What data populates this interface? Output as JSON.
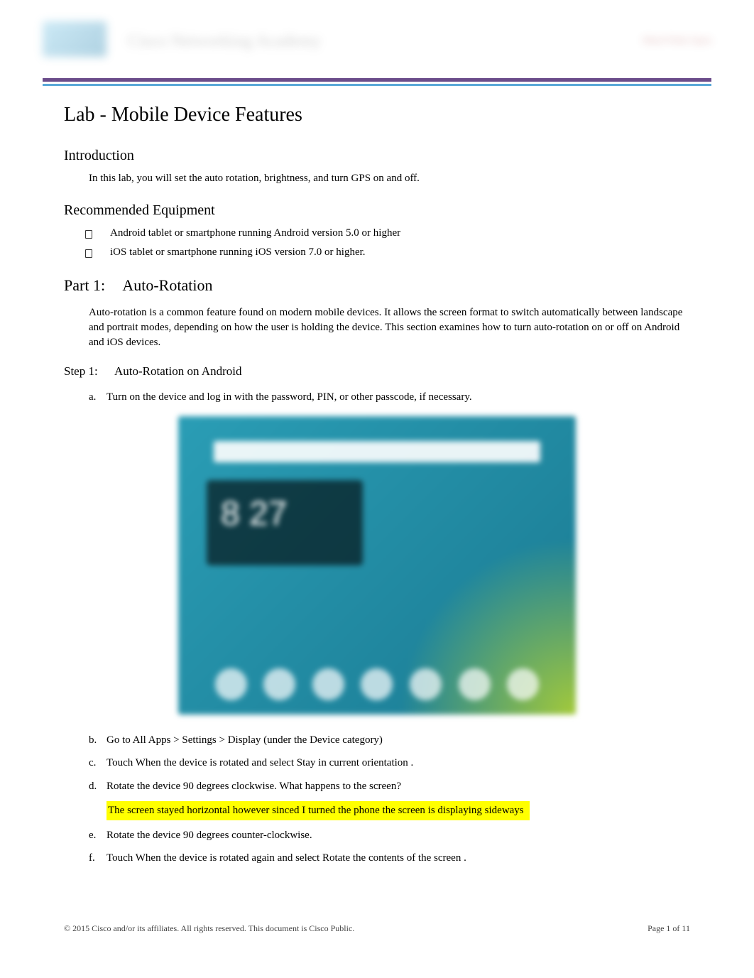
{
  "header": {
    "banner_title": "Cisco Networking Academy",
    "banner_right": "Mind Wide Open"
  },
  "title": "Lab - Mobile Device Features",
  "introduction": {
    "heading": "Introduction",
    "text": "In this lab, you will set the auto rotation, brightness, and turn GPS on and off."
  },
  "recommended": {
    "heading": "Recommended Equipment",
    "items": [
      "Android tablet or smartphone running Android version 5.0 or higher",
      "iOS tablet or smartphone running iOS version 7.0 or higher."
    ]
  },
  "part1": {
    "label": "Part 1:",
    "title": "Auto-Rotation",
    "body": "Auto-rotation is a common feature found on modern mobile devices. It allows the screen format to switch automatically between   landscape   and  portrait  modes, depending on how the user is holding the device. This section examines how to turn    auto-rotation   on or off on Android and iOS devices."
  },
  "step1": {
    "label": "Step 1:",
    "title": "Auto-Rotation on Android",
    "items": {
      "a": "Turn on the device and log in with the password, PIN, or other passcode, if necessary.",
      "b": "Go to  All Apps > Settings > Display      (under the   Device  category)",
      "c": "Touch  When the device is rotated      and select   Stay in current orientation      .",
      "d": "Rotate the device 90 degrees clockwise. What happens to the screen?",
      "d_answer": "The screen stayed horizontal however sinced I turned the phone the screen is displaying sideways",
      "e": "Rotate the device 90 degrees counter-clockwise.",
      "f": "Touch  When the device is rotated      again and select    Rotate the contents of the screen       ."
    }
  },
  "screenshot": {
    "widget_time": "8 27"
  },
  "footer": {
    "copyright": "© 2015 Cisco and/or its affiliates. All rights reserved. This document is Cisco Public.",
    "page": "Page  1 of 11"
  }
}
